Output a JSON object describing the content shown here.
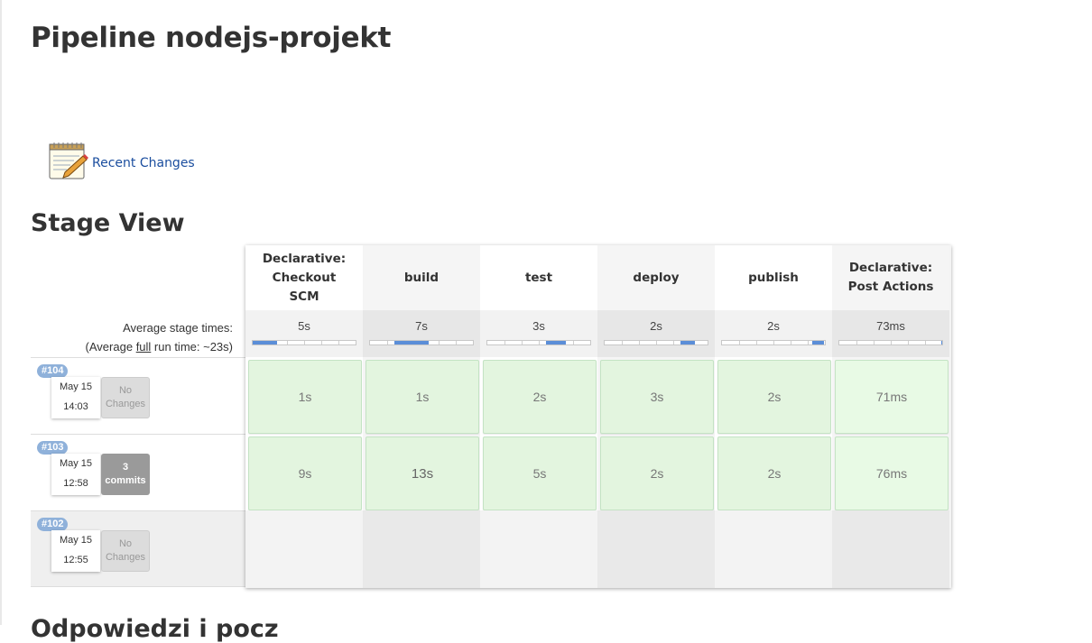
{
  "page": {
    "title": "Pipeline nodejs-projekt"
  },
  "recent_changes": {
    "label": "Recent Changes",
    "icon": "notepad-pencil-icon"
  },
  "stage_view": {
    "title": "Stage View",
    "avg_label": "Average stage times:",
    "avg_full_prefix": "(Average ",
    "avg_full_word": "full",
    "avg_full_suffix": " run time: ~23s)",
    "stages": [
      {
        "name": "Declarative: Checkout SCM",
        "avg": "5s",
        "avg_share": {
          "start": 0.0,
          "end": 0.24
        }
      },
      {
        "name": "build",
        "avg": "7s",
        "avg_share": {
          "start": 0.24,
          "end": 0.57
        }
      },
      {
        "name": "test",
        "avg": "3s",
        "avg_share": {
          "start": 0.57,
          "end": 0.76
        }
      },
      {
        "name": "deploy",
        "avg": "2s",
        "avg_share": {
          "start": 0.74,
          "end": 0.88
        }
      },
      {
        "name": "publish",
        "avg": "2s",
        "avg_share": {
          "start": 0.88,
          "end": 0.99
        }
      },
      {
        "name": "Declarative: Post Actions",
        "avg": "73ms",
        "avg_share": {
          "start": 0.99,
          "end": 1.0
        }
      }
    ],
    "runs": [
      {
        "id": "#104",
        "date": "May 15",
        "time": "14:03",
        "changes_line1": "No",
        "changes_line2": "Changes",
        "has_commits": false,
        "durations": [
          "1s",
          "1s",
          "2s",
          "3s",
          "2s",
          "71ms"
        ]
      },
      {
        "id": "#103",
        "date": "May 15",
        "time": "12:58",
        "changes_line1": "3",
        "changes_line2": "commits",
        "has_commits": true,
        "durations": [
          "9s",
          "13s",
          "5s",
          "2s",
          "2s",
          "76ms"
        ]
      },
      {
        "id": "#102",
        "date": "May 15",
        "time": "12:55",
        "changes_line1": "No",
        "changes_line2": "Changes",
        "has_commits": false,
        "durations": []
      }
    ]
  },
  "next_section": {
    "title": "Odpowiedzi i pocz"
  },
  "colors": {
    "success_cell": "#e3f5df",
    "badge": "#8fb1da",
    "link": "#1a4d9e",
    "bar_fill": "#5b8ed8"
  }
}
